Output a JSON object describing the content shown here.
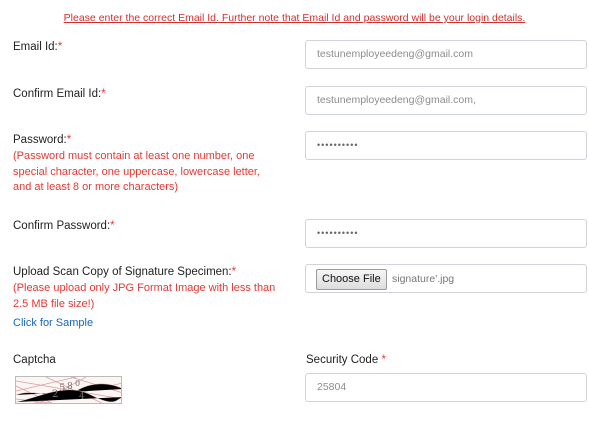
{
  "notice": "Please enter the correct Email Id. Further note that Email Id and password will be your login details.",
  "required_mark": "*",
  "email": {
    "label": "Email Id:",
    "value": "testunemployeedeng@gmail.com"
  },
  "confirm_email": {
    "label": "Confirm Email Id:",
    "value": "testunemployeedeng@gmail.com,"
  },
  "password": {
    "label": "Password:",
    "hint_lines": [
      "(Password must contain at least one number, one",
      "special character, one uppercase, lowercase letter,",
      "and at least 8 or more characters)"
    ],
    "masked_value": "••••••••••"
  },
  "confirm_password": {
    "label": "Confirm Password:",
    "masked_value": "••••••••••"
  },
  "signature": {
    "label": "Upload Scan Copy of Signature Specimen:",
    "hint_lines": [
      "(Please upload only JPG Format Image with less than",
      "2.5 MB file size!)"
    ],
    "sample_link": "Click for Sample",
    "button_label": "Choose File",
    "file_name": "signature'.jpg"
  },
  "captcha": {
    "label": "Captcha",
    "image_text": "25804"
  },
  "security_code": {
    "label": "Security Code ",
    "value": "25804"
  },
  "colors": {
    "error_red": "#e53935",
    "link_blue": "#1565c0",
    "border": "#cfd4da"
  }
}
